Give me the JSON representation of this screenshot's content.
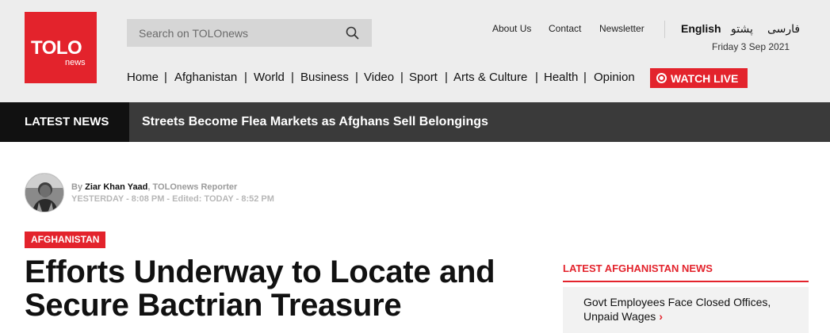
{
  "logo": {
    "brand": "TOLO",
    "sub": "news"
  },
  "search": {
    "placeholder": "Search on TOLOnews"
  },
  "top_links": [
    "About Us",
    "Contact",
    "Newsletter"
  ],
  "languages": [
    "English",
    "پشتو",
    "فارسی"
  ],
  "date": "Friday 3 Sep 2021",
  "nav": [
    "Home",
    "Afghanistan",
    "World",
    "Business",
    "Video",
    "Sport",
    "Arts & Culture",
    "Health",
    "Opinion"
  ],
  "nav_separator": "|",
  "watch_live": "WATCH LIVE",
  "latest_bar": {
    "tag": "LATEST NEWS",
    "headline": "Streets Become Flea Markets as Afghans Sell Belongings"
  },
  "article": {
    "byline_prefix": "By",
    "author": "Ziar Khan Yaad",
    "role": "TOLOnews Reporter",
    "meta": "YESTERDAY - 8:08 PM - Edited: TODAY - 8:52 PM",
    "category": "AFGHANISTAN",
    "title": "Efforts Underway to Locate and Secure Bactrian Treasure"
  },
  "sidebar": {
    "heading": "LATEST AFGHANISTAN NEWS",
    "items": [
      {
        "text": "Govt Employees Face Closed Offices, Unpaid Wages",
        "chevron": "›"
      }
    ]
  },
  "colors": {
    "brand_red": "#e3232c",
    "header_bg": "#ededed",
    "latest_bar_bg": "#3a3a3a"
  }
}
